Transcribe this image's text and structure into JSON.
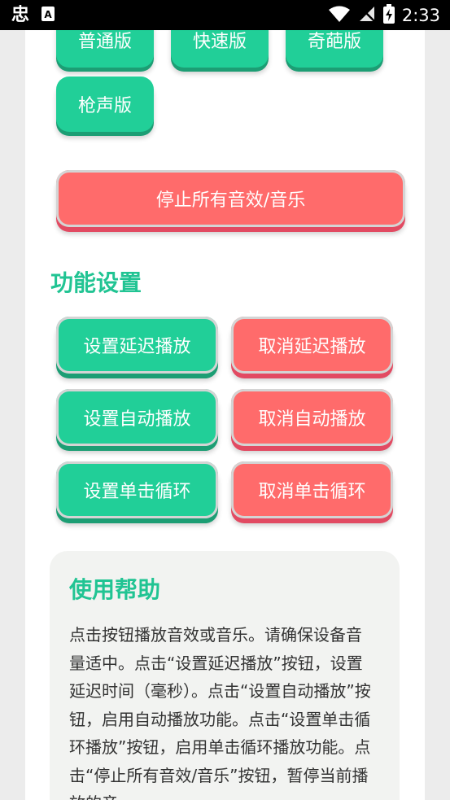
{
  "status_bar": {
    "app_icon_text": "忠",
    "time": "2:33"
  },
  "sound_buttons": [
    {
      "label": "普通版"
    },
    {
      "label": "快速版"
    },
    {
      "label": "奇葩版"
    },
    {
      "label": "枪声版"
    }
  ],
  "stop_all_label": "停止所有音效/音乐",
  "settings": {
    "title": "功能设置",
    "rows": [
      {
        "set": "设置延迟播放",
        "cancel": "取消延迟播放"
      },
      {
        "set": "设置自动播放",
        "cancel": "取消自动播放"
      },
      {
        "set": "设置单击循环",
        "cancel": "取消单击循环"
      }
    ]
  },
  "help": {
    "title": "使用帮助",
    "body": "点击按钮播放音效或音乐。请确保设备音量适中。点击“设置延迟播放”按钮，设置延迟时间（毫秒）。点击“设置自动播放”按钮，启用自动播放功能。点击“设置单击循环播放”按钮，启用单击循环播放功能。点击“停止所有音效/音乐”按钮，暂停当前播放的音"
  },
  "colors": {
    "accent_green": "#21cf98",
    "accent_red": "#ff6b6b",
    "status_bar": "#000000"
  }
}
